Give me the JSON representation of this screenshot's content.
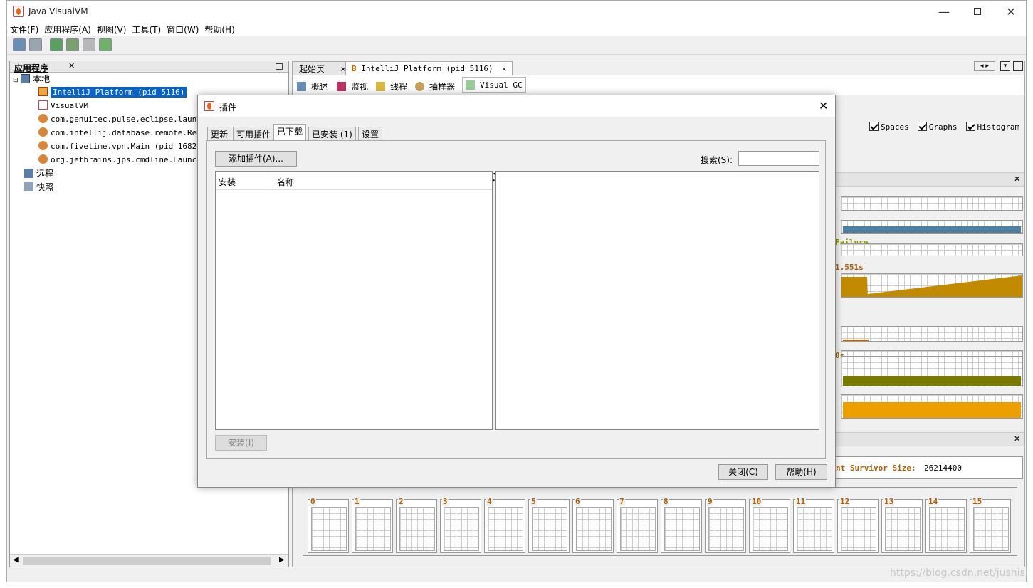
{
  "window": {
    "title": "Java VisualVM"
  },
  "menu": [
    "文件(F)",
    "应用程序(A)",
    "视图(V)",
    "工具(T)",
    "窗口(W)",
    "帮助(H)"
  ],
  "left_panel": {
    "title": "应用程序",
    "tree": [
      {
        "label": "本地",
        "level": 0
      },
      {
        "label": "IntelliJ Platform (pid 5116)",
        "level": 1,
        "selected": true
      },
      {
        "label": "VisualVM",
        "level": 1
      },
      {
        "label": "com.genuitec.pulse.eclipse.launcher",
        "level": 1
      },
      {
        "label": "com.intellij.database.remote.Remote",
        "level": 1
      },
      {
        "label": "com.fivetime.vpn.Main (pid 16820)",
        "level": 1
      },
      {
        "label": "org.jetbrains.jps.cmdline.Launcher",
        "level": 1
      },
      {
        "label": "远程",
        "level": 0
      },
      {
        "label": "快照",
        "level": 0
      }
    ]
  },
  "right_panel": {
    "tabs": [
      "起始页",
      "IntelliJ Platform (pid 5116)"
    ],
    "subtabs": [
      "概述",
      "监视",
      "线程",
      "抽样器",
      "Visual GC"
    ],
    "checkboxes": [
      "Spaces",
      "Graphs",
      "Histogram"
    ],
    "partial_labels": {
      "failure": "Failure",
      "time": "1.551s",
      "zero": "0s",
      "survivor": "nt Survivor Size:",
      "survivor_value": "26214400"
    },
    "histogram_cells": [
      "0",
      "1",
      "2",
      "3",
      "4",
      "5",
      "6",
      "7",
      "8",
      "9",
      "10",
      "11",
      "12",
      "13",
      "14",
      "15"
    ]
  },
  "dialog": {
    "title": "插件",
    "tabs": [
      "更新",
      "可用插件",
      "已下载",
      "已安装 (1)",
      "设置"
    ],
    "active_tab": "已下载",
    "add_button": "添加插件(A)...",
    "search_label": "搜索(S):",
    "search_value": "",
    "columns": [
      "安装",
      "名称"
    ],
    "install_button": "安装(I)",
    "close_button": "关闭(C)",
    "help_button": "帮助(H)"
  },
  "watermark": "https://blog.csdn.net/jushisi"
}
